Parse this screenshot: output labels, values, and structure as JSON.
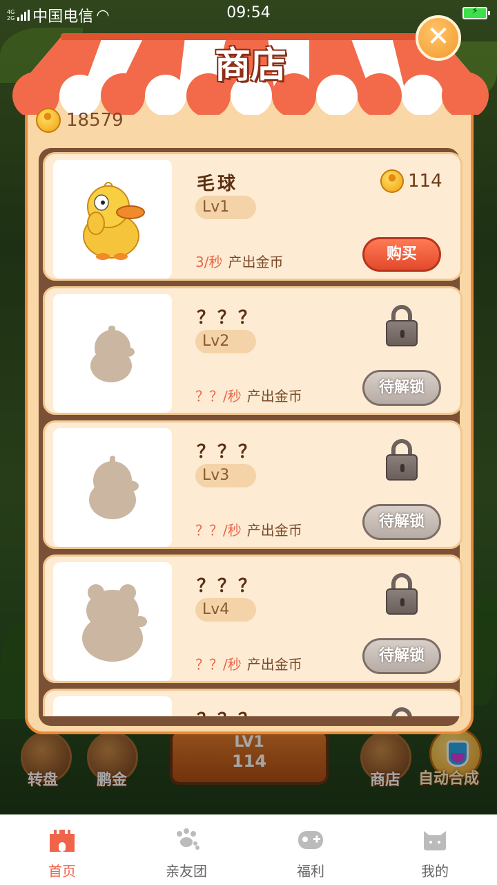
{
  "status_bar": {
    "network_tags": "4G\n2G",
    "carrier": "中国电信",
    "time": "09:54"
  },
  "background_hud": {
    "left_buttons": [
      {
        "label": "转盘",
        "icon": "wheel-icon"
      },
      {
        "label": "鹏金",
        "icon": "house-icon"
      }
    ],
    "center": {
      "level": "LV1",
      "value": "114"
    },
    "right_buttons": [
      {
        "label": "商店",
        "icon": "shop-icon"
      },
      {
        "label": "自动合成",
        "icon": "flask-icon"
      }
    ]
  },
  "shop": {
    "title": "商店",
    "coin_total": "18579",
    "close_label": "✕",
    "items": [
      {
        "name": "毛球",
        "level": "Lv1",
        "rate": "3/秒",
        "rate_desc": "产出金币",
        "price": "114",
        "button": "购买",
        "locked": false
      },
      {
        "name": "？？？",
        "level": "Lv2",
        "rate": "？？/秒",
        "rate_desc": "产出金币",
        "button": "待解锁",
        "locked": true
      },
      {
        "name": "？？？",
        "level": "Lv3",
        "rate": "？？/秒",
        "rate_desc": "产出金币",
        "button": "待解锁",
        "locked": true
      },
      {
        "name": "？？？",
        "level": "Lv4",
        "rate": "？？/秒",
        "rate_desc": "产出金币",
        "button": "待解锁",
        "locked": true
      },
      {
        "name": "？？？",
        "level": "",
        "rate": "",
        "rate_desc": "",
        "button": "",
        "locked": true
      }
    ]
  },
  "tabbar": {
    "tabs": [
      {
        "label": "首页",
        "icon": "castle-icon",
        "active": true
      },
      {
        "label": "亲友团",
        "icon": "paw-icon",
        "active": false
      },
      {
        "label": "福利",
        "icon": "gamepad-icon",
        "active": false
      },
      {
        "label": "我的",
        "icon": "cat-face-icon",
        "active": false
      }
    ]
  },
  "colors": {
    "accent": "#f0654a",
    "panel_bg": "#f9d7a6",
    "awning_red": "#f26a4a",
    "button_buy": "#e24a2c",
    "button_locked": "#b6aca5"
  }
}
